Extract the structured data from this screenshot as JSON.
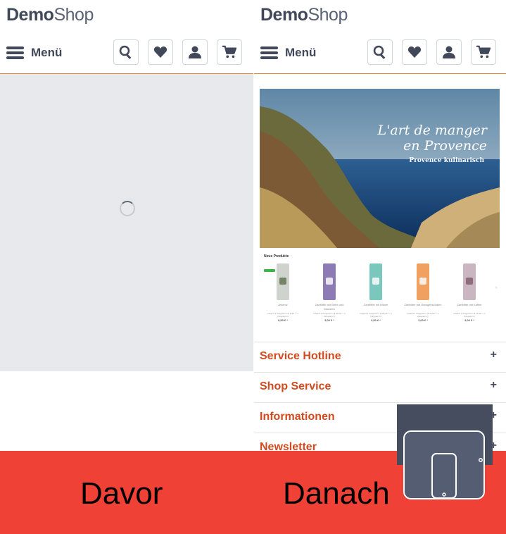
{
  "logo": {
    "bold": "Demo",
    "light": "Shop"
  },
  "header": {
    "menu_label": "Menü"
  },
  "hero": {
    "title_line1": "L'art de manger",
    "title_line2": "en Provence",
    "subtitle": "Provence kulinarisch"
  },
  "new_products": {
    "title": "Neue Produkte",
    "items": [
      {
        "name": "Arsenic",
        "info": "Inhalt 0.1 Kilogramm (€ 0,99 * / 1 Kilogramm)",
        "price": "8,90 € *",
        "color": "#cfd3cd",
        "accent": "#5c6e4b"
      },
      {
        "name": "Zartbitter mit Birne und Mandeln",
        "info": "Inhalt 0.1 Kilogramm (€ 99,00 * / 1 Kilogramm)",
        "price": "3,00 € *",
        "color": "#8d7bb5",
        "accent": "#ffffff"
      },
      {
        "name": "Zartbitter mit Minze",
        "info": "Inhalt 0.1 Kilogramm (€ 55,00 * / 1 Kilogramm)",
        "price": "3,50 € *",
        "color": "#7ac7bd",
        "accent": "#ffffff"
      },
      {
        "name": "Zartbitter mit Orangenschalen",
        "info": "Inhalt 0.1 Kilogramm (€ 33,00 * / 1 Kilogramm)",
        "price": "3,00 € *",
        "color": "#f0a061",
        "accent": "#ffffff"
      },
      {
        "name": "Zartbitter mit Kaffee",
        "info": "Inhalt 0.1 Kilogramm (€ 33,00 * / 1 Kilogramm)",
        "price": "3,00 € *",
        "color": "#c9b6c0",
        "accent": "#7d5a6b"
      }
    ]
  },
  "accordion": [
    {
      "label": "Service Hotline"
    },
    {
      "label": "Shop Service"
    },
    {
      "label": "Informationen"
    },
    {
      "label": "Newsletter"
    }
  ],
  "labels": {
    "before": "Davor",
    "after": "Danach"
  },
  "icons": {
    "search": "search-icon",
    "wishlist": "heart-icon",
    "account": "user-icon",
    "cart": "cart-icon"
  },
  "colors": {
    "accent": "#d24a20",
    "bar": "#ef4135",
    "dark": "#404859"
  }
}
